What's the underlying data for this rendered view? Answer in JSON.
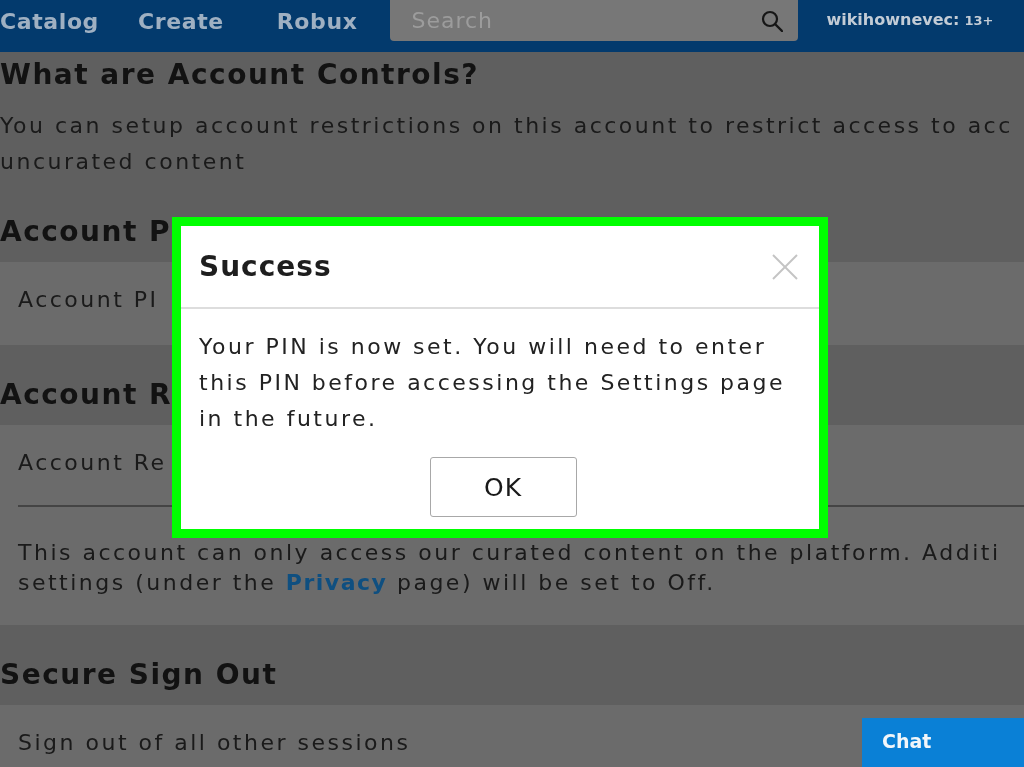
{
  "nav": {
    "links": [
      {
        "label": "Catalog"
      },
      {
        "label": "Create"
      },
      {
        "label": "Robux"
      }
    ],
    "search": {
      "placeholder": "Search"
    },
    "username": "wikihownevec:",
    "age_badge": "13+"
  },
  "intro": {
    "title": "What are Account Controls?",
    "text": "You can setup account restrictions on this account to restrict access to acc\nuncurated content"
  },
  "sections": [
    {
      "title": "Account P",
      "rows": [
        {
          "kind": "label",
          "text": "Account PI"
        }
      ]
    },
    {
      "title": "Account R",
      "rows": [
        {
          "kind": "label",
          "text": "Account Re"
        },
        {
          "kind": "note",
          "text": "This account can only access our curated content on the platform. Additi\nsettings (under the ",
          "link": "Privacy",
          "text_after": " page) will be set to Off."
        }
      ]
    },
    {
      "title": "Secure Sign Out",
      "rows": [
        {
          "kind": "label",
          "text": "Sign out of all other sessions"
        }
      ]
    }
  ],
  "dialog": {
    "title": "Success",
    "message": "Your PIN is now set. You will need to enter this PIN before accessing the Settings page in the future.",
    "buttons": [
      {
        "label": "OK"
      }
    ]
  },
  "chat": {
    "label": "Chat"
  }
}
